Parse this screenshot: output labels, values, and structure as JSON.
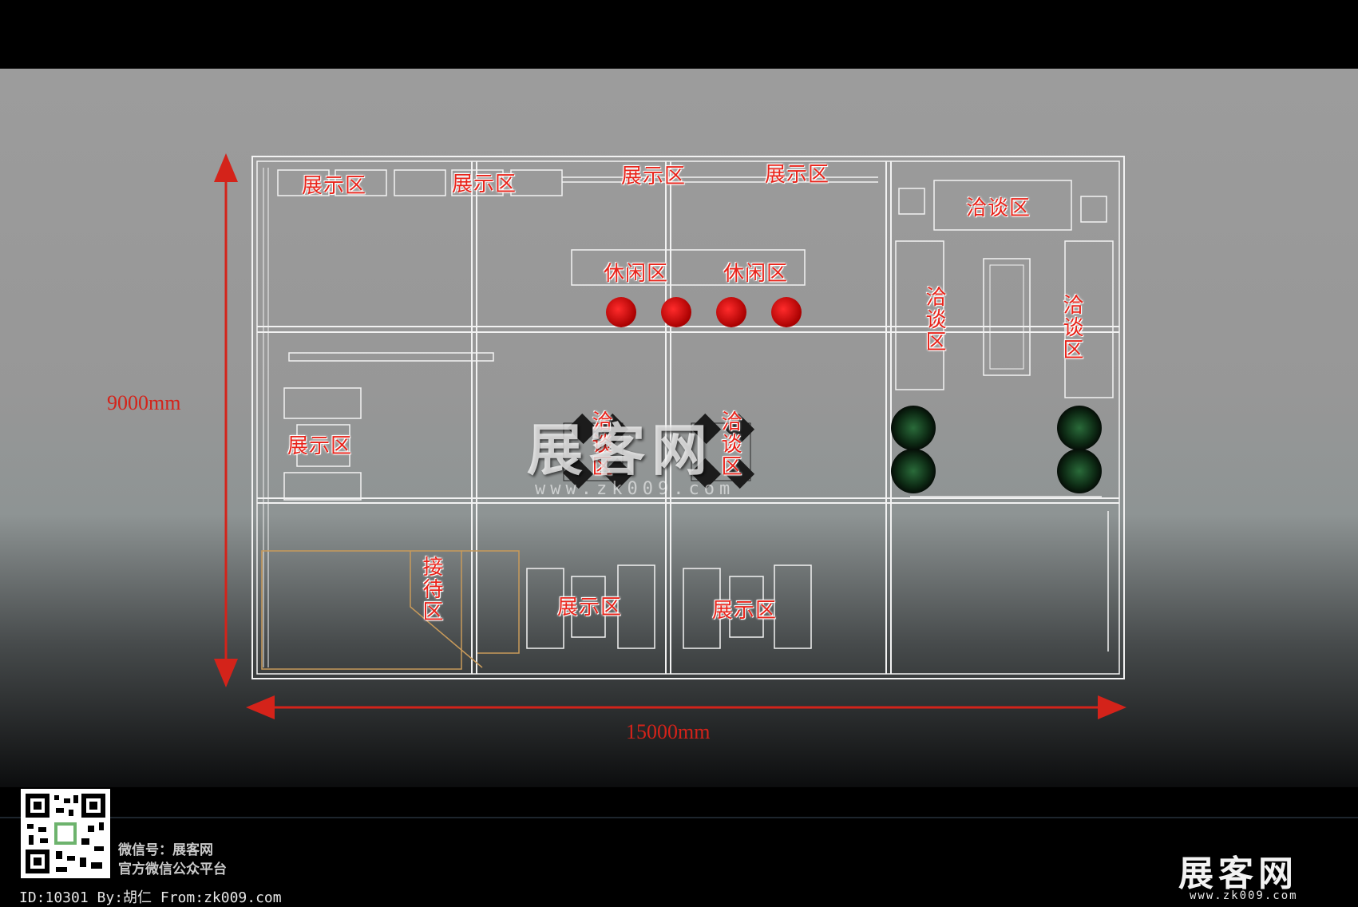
{
  "plan": {
    "width_label": "15000mm",
    "height_label": "9000mm",
    "zones": {
      "display_top_1": "展示区",
      "display_top_2": "展示区",
      "display_top_3": "展示区",
      "display_top_4": "展示区",
      "leisure_1": "休闲区",
      "leisure_2": "休闲区",
      "nego_top_right": "洽谈区",
      "nego_right_left": "洽谈区",
      "nego_right_right": "洽谈区",
      "display_left": "展示区",
      "nego_center_1": "洽谈区",
      "nego_center_2": "洽谈区",
      "reception": "接待区",
      "display_bottom_1": "展示区",
      "display_bottom_2": "展示区"
    },
    "colors": {
      "dimension": "#d4231a",
      "zone_text": "#e8231a",
      "seat": "#d01010",
      "wall": "#f0f0f0"
    }
  },
  "watermark": {
    "brand": "展客网",
    "url": "www.zk009.com"
  },
  "footer": {
    "wechat_line": "微信号：展客网",
    "platform_line": "官方微信公众平台",
    "id_line": "ID:10301 By:胡仁 From:zk009.com",
    "logo_text": "展客网",
    "logo_url": "www.zk009.com"
  }
}
